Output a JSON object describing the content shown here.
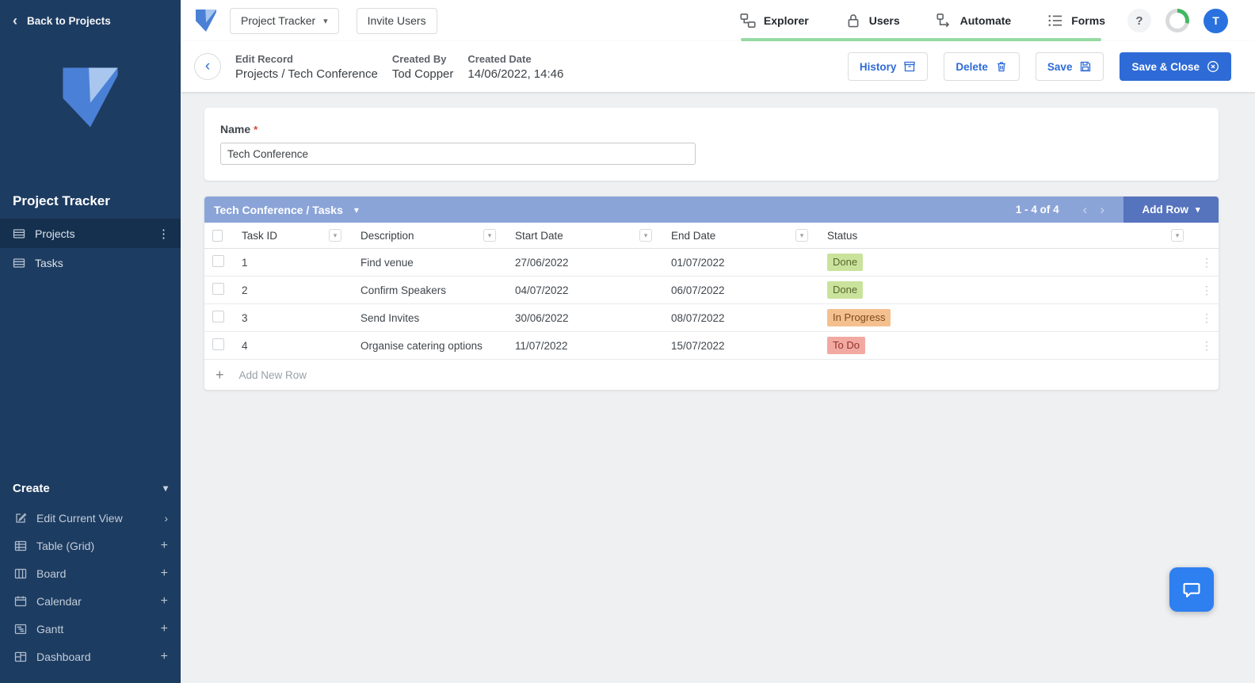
{
  "colors": {
    "accent_blue": "#2e6bd6",
    "sidebar_navy": "#1d3c61",
    "grid_header_blue": "#8ba4d8",
    "add_row_blue": "#5673bd",
    "status_done_bg": "#c9e39c",
    "status_in_progress_bg": "#f4c08f",
    "status_to_do_bg": "#f1a9a1",
    "nav_underline_green": "#97dca4"
  },
  "icons": {
    "chevron_down": "▾",
    "chevron_left": "‹",
    "chevron_right": "›",
    "plus": "+",
    "kebab": "⋮",
    "help": "?",
    "asterisk": "*"
  },
  "sidebar": {
    "back_label": "Back to Projects",
    "title": "Project Tracker",
    "items": [
      {
        "label": "Projects",
        "active": true
      },
      {
        "label": "Tasks",
        "active": false
      }
    ],
    "create_label": "Create",
    "create_items": [
      {
        "label": "Edit Current View"
      },
      {
        "label": "Table (Grid)"
      },
      {
        "label": "Board"
      },
      {
        "label": "Calendar"
      },
      {
        "label": "Gantt"
      },
      {
        "label": "Dashboard"
      }
    ]
  },
  "topbar": {
    "workspace_button": "Project Tracker",
    "invite_button": "Invite Users",
    "nav": [
      {
        "label": "Explorer"
      },
      {
        "label": "Users"
      },
      {
        "label": "Automate"
      },
      {
        "label": "Forms"
      }
    ],
    "avatar_initial": "T"
  },
  "page_header": {
    "mode_label": "Edit Record",
    "record_breadcrumb": "Projects / Tech Conference",
    "created_by_label": "Created By",
    "created_by_value": "Tod Copper",
    "created_date_label": "Created Date",
    "created_date_value": "14/06/2022, 14:46",
    "history_button": "History",
    "delete_button": "Delete",
    "save_button": "Save",
    "save_close_button": "Save & Close"
  },
  "form": {
    "name_label": "Name",
    "name_value": "Tech Conference"
  },
  "grid": {
    "title": "Tech Conference / Tasks",
    "range_label": "1 - 4 of 4",
    "add_row_button": "Add Row",
    "add_new_row_label": "Add New Row",
    "columns": [
      "Task ID",
      "Description",
      "Start Date",
      "End Date",
      "Status"
    ],
    "rows": [
      {
        "task_id": "1",
        "description": "Find venue",
        "start_date": "27/06/2022",
        "end_date": "01/07/2022",
        "status": "Done"
      },
      {
        "task_id": "2",
        "description": "Confirm Speakers",
        "start_date": "04/07/2022",
        "end_date": "06/07/2022",
        "status": "Done"
      },
      {
        "task_id": "3",
        "description": "Send Invites",
        "start_date": "30/06/2022",
        "end_date": "08/07/2022",
        "status": "In Progress"
      },
      {
        "task_id": "4",
        "description": "Organise catering options",
        "start_date": "11/07/2022",
        "end_date": "15/07/2022",
        "status": "To Do"
      }
    ]
  }
}
